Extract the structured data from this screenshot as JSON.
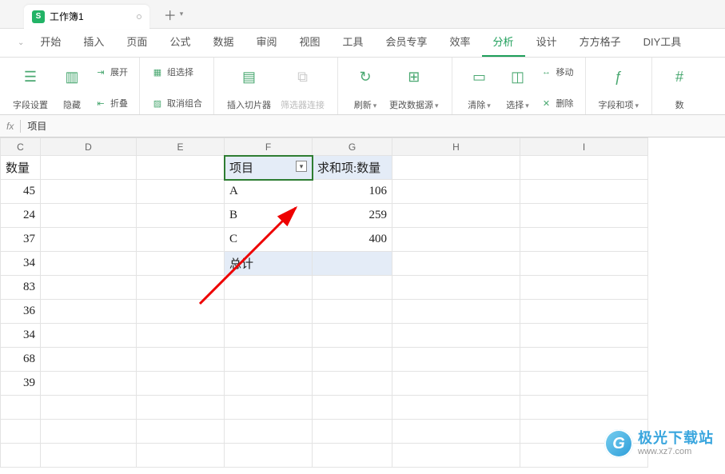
{
  "doc_tab": {
    "icon_letter": "S",
    "title": "工作簿1"
  },
  "menu": {
    "items": [
      "开始",
      "插入",
      "页面",
      "公式",
      "数据",
      "审阅",
      "视图",
      "工具",
      "会员专享",
      "效率",
      "分析",
      "设计",
      "方方格子",
      "DIY工具"
    ],
    "active_index": 10
  },
  "ribbon": {
    "field_settings": "字段设置",
    "hide": "隐藏",
    "expand": "展开",
    "collapse": "折叠",
    "group_select": "组选择",
    "ungroup": "取消组合",
    "insert_slicer": "插入切片器",
    "filter_conn": "筛选器连接",
    "refresh": "刷新",
    "change_source": "更改数据源",
    "clear": "清除",
    "select": "选择",
    "move": "移动",
    "delete": "删除",
    "fields_items": "字段和项",
    "num": "数"
  },
  "formula_bar": {
    "fx": "fx",
    "value": "项目"
  },
  "columns": [
    "C",
    "D",
    "E",
    "F",
    "G",
    "H",
    "I"
  ],
  "col_c_header": "数量",
  "col_c_values": [
    45,
    24,
    37,
    34,
    83,
    36,
    34,
    68,
    39
  ],
  "pivot": {
    "row_label_hdr": "项目",
    "value_hdr": "求和项:数量",
    "rows": [
      {
        "label": "A",
        "value": 106
      },
      {
        "label": "B",
        "value": 259
      },
      {
        "label": "C",
        "value": 400
      }
    ],
    "total_label": "总计"
  },
  "watermark": {
    "logo_letter": "G",
    "name": "极光下载站",
    "url": "www.xz7.com"
  }
}
